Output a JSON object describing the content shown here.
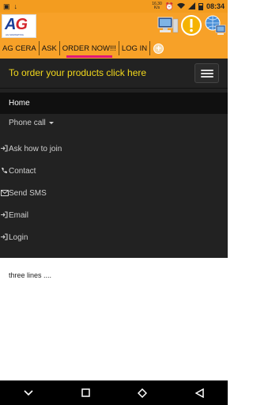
{
  "status_bar": {
    "net_speed_value": "16.30",
    "net_speed_unit": "K/s",
    "time": "08:34",
    "icons": [
      "image-icon",
      "download-icon",
      "alarm-icon",
      "wifi-icon",
      "signal-icon",
      "battery-icon"
    ]
  },
  "header": {
    "logo_letter_a": "A",
    "logo_letter_g": "G",
    "logo_subtitle": "AG MARKETING",
    "icons": [
      "computer-icon",
      "alert-icon",
      "globe-computer-icon"
    ]
  },
  "tabs": [
    {
      "label": "AG CERA"
    },
    {
      "label": "ASK"
    },
    {
      "label": "ORDER NOW!!!"
    },
    {
      "label": "LOG IN"
    }
  ],
  "tab_plus": "+",
  "promo": {
    "text": "To order your products click here"
  },
  "menu": {
    "home": "Home",
    "phone_call": "Phone call",
    "items": [
      {
        "label": "Ask how to join",
        "icon": "sign-in-icon"
      },
      {
        "label": "Contact",
        "icon": "phone-icon"
      },
      {
        "label": "Send SMS",
        "icon": "envelope-icon"
      },
      {
        "label": "Email",
        "icon": "sign-in-icon"
      },
      {
        "label": "Login",
        "icon": "sign-in-icon"
      }
    ]
  },
  "content": {
    "text": "three lines ...."
  },
  "colors": {
    "header_orange": "#f7a128",
    "navbar_dark": "#222222",
    "promo_yellow": "#f2d81c",
    "active_tab_underline": "#e0177a"
  }
}
